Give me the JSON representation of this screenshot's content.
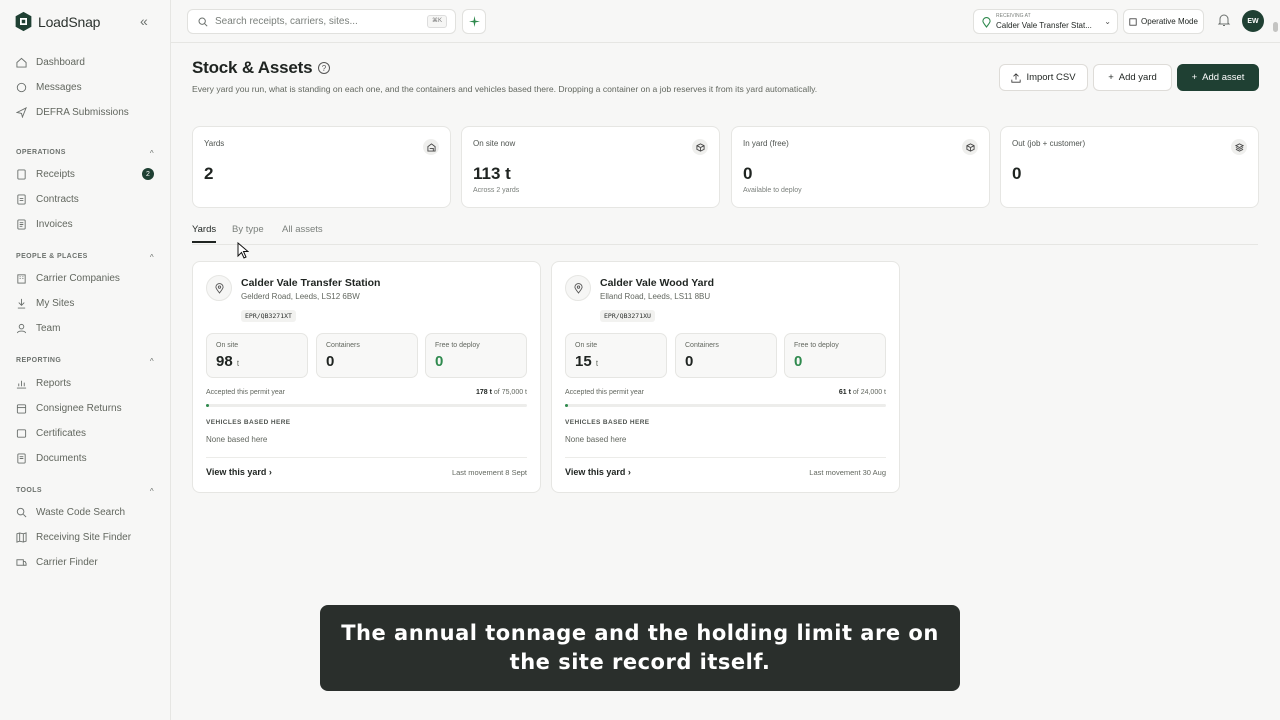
{
  "app": {
    "name": "LoadSnap",
    "collapse_icon": "«"
  },
  "nav": [
    {
      "label": "Dashboard",
      "icon": "home-icon"
    },
    {
      "label": "Messages",
      "icon": "chat-icon"
    },
    {
      "label": "DEFRA Submissions",
      "icon": "send-icon"
    }
  ],
  "sections": [
    {
      "title": "OPERATIONS",
      "items": [
        {
          "label": "Receipts",
          "badge": "2"
        },
        {
          "label": "Contracts"
        },
        {
          "label": "Invoices"
        }
      ]
    },
    {
      "title": "PEOPLE & PLACES",
      "items": [
        {
          "label": "Carrier Companies"
        },
        {
          "label": "My Sites"
        },
        {
          "label": "Team"
        }
      ]
    },
    {
      "title": "REPORTING",
      "items": [
        {
          "label": "Reports"
        },
        {
          "label": "Consignee Returns"
        },
        {
          "label": "Certificates"
        },
        {
          "label": "Documents"
        }
      ]
    },
    {
      "title": "TOOLS",
      "items": [
        {
          "label": "Waste Code Search"
        },
        {
          "label": "Receiving Site Finder"
        },
        {
          "label": "Carrier Finder"
        }
      ]
    }
  ],
  "topbar": {
    "search_placeholder": "Search receipts, carriers, sites...",
    "search_shortcut": "⌘K",
    "receiving_label": "RECEIVING AT",
    "receiving_value": "Calder Vale Transfer Stat...",
    "operative_mode": "Operative Mode",
    "avatar": "EW"
  },
  "page": {
    "title": "Stock & Assets",
    "subtitle": "Every yard you run, what is standing on each one, and the containers and vehicles based there. Dropping a container on a job reserves it from its yard automatically.",
    "buttons": {
      "import": "Import CSV",
      "add_yard": "Add yard",
      "add_asset": "Add asset"
    }
  },
  "stats": [
    {
      "label": "Yards",
      "value": "2",
      "unit": "",
      "note": ""
    },
    {
      "label": "On site now",
      "value": "113",
      "unit": "t",
      "note": "Across 2 yards"
    },
    {
      "label": "In yard (free)",
      "value": "0",
      "unit": "",
      "note": "Available to deploy"
    },
    {
      "label": "Out (job + customer)",
      "value": "0",
      "unit": "",
      "note": ""
    }
  ],
  "tabs": [
    "Yards",
    "By type",
    "All assets"
  ],
  "yards": [
    {
      "name": "Calder Vale Transfer Station",
      "address": "Gelderd Road, Leeds, LS12 6BW",
      "epr": "EPR/QB3271XT",
      "on_site_label": "On site",
      "on_site": "98",
      "on_site_unit": "t",
      "containers_label": "Containers",
      "containers": "0",
      "free_label": "Free to deploy",
      "free": "0",
      "accepted_label": "Accepted this permit year",
      "accepted_value": "178 t",
      "accepted_limit": "of 75,000 t",
      "accepted_fraction": 0.0024,
      "vehicles_label": "VEHICLES BASED HERE",
      "vehicles_value": "None based here",
      "view": "View this yard",
      "last": "Last movement 8 Sept"
    },
    {
      "name": "Calder Vale Wood Yard",
      "address": "Elland Road, Leeds, LS11 8BU",
      "epr": "EPR/QB3271XU",
      "on_site_label": "On site",
      "on_site": "15",
      "on_site_unit": "t",
      "containers_label": "Containers",
      "containers": "0",
      "free_label": "Free to deploy",
      "free": "0",
      "accepted_label": "Accepted this permit year",
      "accepted_value": "61 t",
      "accepted_limit": "of 24,000 t",
      "accepted_fraction": 0.0025,
      "vehicles_label": "VEHICLES BASED HERE",
      "vehicles_value": "None based here",
      "view": "View this yard",
      "last": "Last movement 30 Aug"
    }
  ],
  "caption": "The annual tonnage and the holding limit are on the site record itself.",
  "colors": {
    "primary": "#1f4033",
    "green": "#2f8a4e"
  }
}
